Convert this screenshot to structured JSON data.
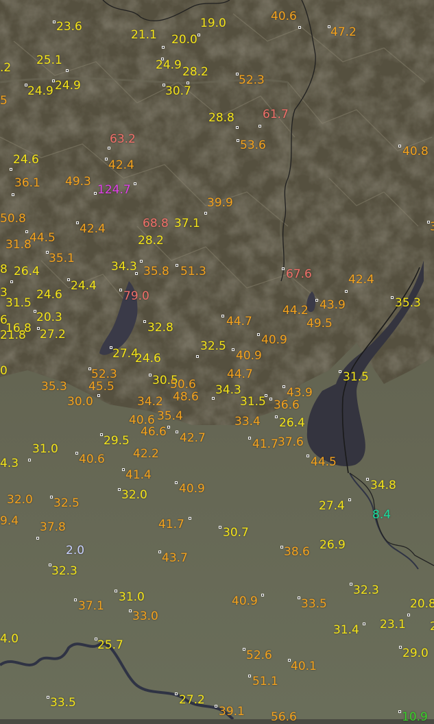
{
  "colors": {
    "terrain_mountain": "#5b5647",
    "terrain_valley": "#6a6656",
    "plain": "#666b58",
    "lake": "#3a3a48",
    "river": "#2f3344",
    "border": "#1c1c1c",
    "yellow": "#f5e51a",
    "orange": "#f5a31e",
    "red": "#f2706a",
    "magenta": "#e040e8",
    "lightblue": "#c8d0ff",
    "teal": "#19e0a0",
    "green": "#39d12a"
  },
  "readings": [
    {
      "id": "r1",
      "text": "23.6",
      "tier": "yellow"
    },
    {
      "id": "r2",
      "text": "21.1",
      "tier": "yellow"
    },
    {
      "id": "r3",
      "text": "20.0",
      "tier": "yellow"
    },
    {
      "id": "r4",
      "text": "19.0",
      "tier": "yellow"
    },
    {
      "id": "r5",
      "text": "40.6",
      "tier": "orange"
    },
    {
      "id": "r6",
      "text": "47.2",
      "tier": "orange"
    },
    {
      "id": "r7",
      "text": "25.1",
      "tier": "yellow"
    },
    {
      "id": "r8",
      "text": ".2",
      "tier": "yellow"
    },
    {
      "id": "r9",
      "text": "24.9",
      "tier": "yellow"
    },
    {
      "id": "r10",
      "text": "24.9",
      "tier": "yellow"
    },
    {
      "id": "r11",
      "text": "24.9",
      "tier": "yellow"
    },
    {
      "id": "r12",
      "text": "28.2",
      "tier": "yellow"
    },
    {
      "id": "r13",
      "text": "30.7",
      "tier": "yellow"
    },
    {
      "id": "r14",
      "text": "52.3",
      "tier": "orange"
    },
    {
      "id": "r15",
      "text": "5",
      "tier": "orange"
    },
    {
      "id": "r16",
      "text": "28.8",
      "tier": "yellow"
    },
    {
      "id": "r17",
      "text": "61.7",
      "tier": "red"
    },
    {
      "id": "r18",
      "text": "63.2",
      "tier": "red"
    },
    {
      "id": "r19",
      "text": "53.6",
      "tier": "orange"
    },
    {
      "id": "r20",
      "text": "40.8",
      "tier": "orange"
    },
    {
      "id": "r21",
      "text": "24.6",
      "tier": "yellow"
    },
    {
      "id": "r22",
      "text": "42.4",
      "tier": "orange"
    },
    {
      "id": "r23",
      "text": "36.1",
      "tier": "orange"
    },
    {
      "id": "r24",
      "text": "49.3",
      "tier": "orange"
    },
    {
      "id": "r25",
      "text": "124.7",
      "tier": "magenta"
    },
    {
      "id": "r26",
      "text": "39.9",
      "tier": "orange"
    },
    {
      "id": "r27",
      "text": "50.8",
      "tier": "orange"
    },
    {
      "id": "r28",
      "text": "42.4",
      "tier": "orange"
    },
    {
      "id": "r29",
      "text": "68.8",
      "tier": "red"
    },
    {
      "id": "r30",
      "text": "37.1",
      "tier": "yellow"
    },
    {
      "id": "r31",
      "text": "3",
      "tier": "orange"
    },
    {
      "id": "r32",
      "text": "31.8",
      "tier": "orange"
    },
    {
      "id": "r33",
      "text": "44.5",
      "tier": "orange"
    },
    {
      "id": "r34",
      "text": "28.2",
      "tier": "yellow"
    },
    {
      "id": "r35",
      "text": "35.1",
      "tier": "orange"
    },
    {
      "id": "r36",
      "text": "8",
      "tier": "yellow"
    },
    {
      "id": "r37",
      "text": "26.4",
      "tier": "yellow"
    },
    {
      "id": "r38",
      "text": "34.3",
      "tier": "yellow"
    },
    {
      "id": "r39",
      "text": "35.8",
      "tier": "orange"
    },
    {
      "id": "r40",
      "text": "51.3",
      "tier": "orange"
    },
    {
      "id": "r41",
      "text": "67.6",
      "tier": "red"
    },
    {
      "id": "r42",
      "text": "42.4",
      "tier": "orange"
    },
    {
      "id": "r43",
      "text": "24.4",
      "tier": "yellow"
    },
    {
      "id": "r44",
      "text": "3",
      "tier": "yellow"
    },
    {
      "id": "r45",
      "text": "24.6",
      "tier": "yellow"
    },
    {
      "id": "r46",
      "text": "79.0",
      "tier": "red"
    },
    {
      "id": "r47",
      "text": "31.5",
      "tier": "yellow"
    },
    {
      "id": "r48",
      "text": "35.3",
      "tier": "yellow"
    },
    {
      "id": "r49",
      "text": "43.9",
      "tier": "orange"
    },
    {
      "id": "r50",
      "text": "44.2",
      "tier": "orange"
    },
    {
      "id": "r51",
      "text": "6",
      "tier": "yellow"
    },
    {
      "id": "r52",
      "text": "20.3",
      "tier": "yellow"
    },
    {
      "id": "r53",
      "text": "49.5",
      "tier": "orange"
    },
    {
      "id": "r54",
      "text": "21.8",
      "tier": "yellow"
    },
    {
      "id": "r55",
      "text": "16.8",
      "tier": "yellow"
    },
    {
      "id": "r56",
      "text": "27.2",
      "tier": "yellow"
    },
    {
      "id": "r57",
      "text": "44.7",
      "tier": "orange"
    },
    {
      "id": "r58",
      "text": "32.8",
      "tier": "yellow"
    },
    {
      "id": "r59",
      "text": "40.9",
      "tier": "orange"
    },
    {
      "id": "r60",
      "text": "27.4",
      "tier": "yellow"
    },
    {
      "id": "r61",
      "text": "32.5",
      "tier": "yellow"
    },
    {
      "id": "r62",
      "text": "0",
      "tier": "yellow"
    },
    {
      "id": "r63",
      "text": "24.6",
      "tier": "yellow"
    },
    {
      "id": "r64",
      "text": "40.9",
      "tier": "orange"
    },
    {
      "id": "r65",
      "text": "52.3",
      "tier": "orange"
    },
    {
      "id": "r66",
      "text": "44.7",
      "tier": "orange"
    },
    {
      "id": "r67",
      "text": "31.5",
      "tier": "yellow"
    },
    {
      "id": "r68",
      "text": "35.3",
      "tier": "orange"
    },
    {
      "id": "r69",
      "text": "45.5",
      "tier": "orange"
    },
    {
      "id": "r70",
      "text": "30.5",
      "tier": "yellow"
    },
    {
      "id": "r71",
      "text": "50.6",
      "tier": "orange"
    },
    {
      "id": "r72",
      "text": "34.3",
      "tier": "yellow"
    },
    {
      "id": "r73",
      "text": "43.9",
      "tier": "orange"
    },
    {
      "id": "r74",
      "text": "30.0",
      "tier": "orange"
    },
    {
      "id": "r75",
      "text": "34.2",
      "tier": "orange"
    },
    {
      "id": "r76",
      "text": "48.6",
      "tier": "orange"
    },
    {
      "id": "r77",
      "text": "31.5",
      "tier": "yellow"
    },
    {
      "id": "r78",
      "text": "36.6",
      "tier": "orange"
    },
    {
      "id": "r79",
      "text": "40.6",
      "tier": "orange"
    },
    {
      "id": "r80",
      "text": "35.4",
      "tier": "orange"
    },
    {
      "id": "r81",
      "text": "33.4",
      "tier": "orange"
    },
    {
      "id": "r82",
      "text": "26.4",
      "tier": "yellow"
    },
    {
      "id": "r83",
      "text": "29.5",
      "tier": "yellow"
    },
    {
      "id": "r84",
      "text": "46.6",
      "tier": "orange"
    },
    {
      "id": "r85",
      "text": "42.7",
      "tier": "orange"
    },
    {
      "id": "r86",
      "text": "41.7",
      "tier": "orange"
    },
    {
      "id": "r87",
      "text": "37.6",
      "tier": "orange"
    },
    {
      "id": "r88",
      "text": "31.0",
      "tier": "yellow"
    },
    {
      "id": "r89",
      "text": "40.6",
      "tier": "orange"
    },
    {
      "id": "r90",
      "text": "42.2",
      "tier": "orange"
    },
    {
      "id": "r91",
      "text": "44.5",
      "tier": "orange"
    },
    {
      "id": "r92",
      "text": "4.3",
      "tier": "yellow"
    },
    {
      "id": "r93",
      "text": "41.4",
      "tier": "orange"
    },
    {
      "id": "r94",
      "text": "34.8",
      "tier": "yellow"
    },
    {
      "id": "r95",
      "text": "40.9",
      "tier": "orange"
    },
    {
      "id": "r96",
      "text": "32.0",
      "tier": "yellow"
    },
    {
      "id": "r97",
      "text": "32.0",
      "tier": "orange"
    },
    {
      "id": "r98",
      "text": "32.5",
      "tier": "orange"
    },
    {
      "id": "r99",
      "text": "27.4",
      "tier": "yellow"
    },
    {
      "id": "r100",
      "text": "8.4",
      "tier": "teal"
    },
    {
      "id": "r101",
      "text": "9.4",
      "tier": "orange"
    },
    {
      "id": "r102",
      "text": "37.8",
      "tier": "orange"
    },
    {
      "id": "r103",
      "text": "41.7",
      "tier": "orange"
    },
    {
      "id": "r104",
      "text": "30.7",
      "tier": "yellow"
    },
    {
      "id": "r105",
      "text": "2.0",
      "tier": "lightblue"
    },
    {
      "id": "r106",
      "text": "38.6",
      "tier": "orange"
    },
    {
      "id": "r107",
      "text": "26.9",
      "tier": "yellow"
    },
    {
      "id": "r108",
      "text": "43.7",
      "tier": "orange"
    },
    {
      "id": "r109",
      "text": "32.3",
      "tier": "yellow"
    },
    {
      "id": "r110",
      "text": "32.3",
      "tier": "yellow"
    },
    {
      "id": "r111",
      "text": "31.0",
      "tier": "yellow"
    },
    {
      "id": "r112",
      "text": "37.1",
      "tier": "orange"
    },
    {
      "id": "r113",
      "text": "40.9",
      "tier": "orange"
    },
    {
      "id": "r114",
      "text": "33.5",
      "tier": "orange"
    },
    {
      "id": "r115",
      "text": "20.8",
      "tier": "yellow"
    },
    {
      "id": "r116",
      "text": "33.0",
      "tier": "orange"
    },
    {
      "id": "r117",
      "text": "31.4",
      "tier": "yellow"
    },
    {
      "id": "r118",
      "text": "23.1",
      "tier": "yellow"
    },
    {
      "id": "r119",
      "text": "2",
      "tier": "yellow"
    },
    {
      "id": "r120",
      "text": "4.0",
      "tier": "yellow"
    },
    {
      "id": "r121",
      "text": "25.7",
      "tier": "yellow"
    },
    {
      "id": "r122",
      "text": "29.0",
      "tier": "yellow"
    },
    {
      "id": "r123",
      "text": "52.6",
      "tier": "orange"
    },
    {
      "id": "r124",
      "text": "40.1",
      "tier": "orange"
    },
    {
      "id": "r125",
      "text": "51.1",
      "tier": "orange"
    },
    {
      "id": "r126",
      "text": "33.5",
      "tier": "yellow"
    },
    {
      "id": "r127",
      "text": "27.2",
      "tier": "yellow"
    },
    {
      "id": "r128",
      "text": "39.1",
      "tier": "orange"
    },
    {
      "id": "r129",
      "text": "56.6",
      "tier": "orange"
    },
    {
      "id": "r130",
      "text": "10.9",
      "tier": "green"
    }
  ]
}
